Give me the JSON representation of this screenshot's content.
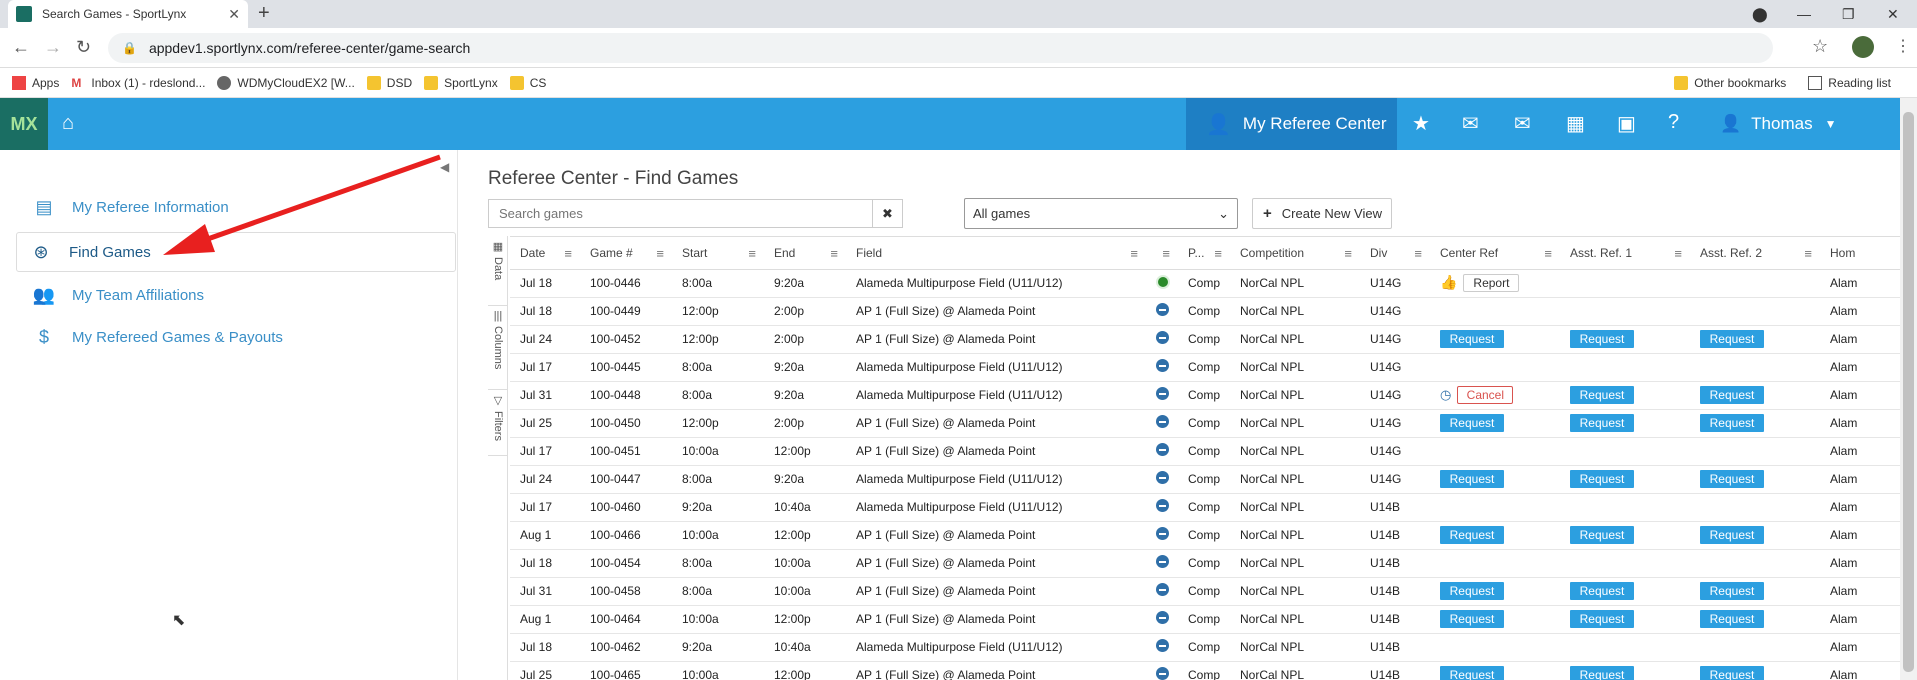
{
  "browser": {
    "tab_title": "Search Games - SportLynx",
    "url": "appdev1.sportlynx.com/referee-center/game-search",
    "bookmarks": [
      "Apps",
      "Inbox (1) - rdeslond...",
      "WDMyCloudEX2 [W...",
      "DSD",
      "SportLynx",
      "CS"
    ],
    "other_bookmarks": "Other bookmarks",
    "reading_list": "Reading list"
  },
  "appnav": {
    "logo": "MX",
    "center_label": "My Referee Center",
    "user_name": "Thomas"
  },
  "sidebar": {
    "items": [
      {
        "label": "My Referee Information",
        "icon": "id-card-icon"
      },
      {
        "label": "Find Games",
        "icon": "search-globe-icon",
        "active": true
      },
      {
        "label": "My Team Affiliations",
        "icon": "users-icon"
      },
      {
        "label": "My Refereed Games & Payouts",
        "icon": "dollar-icon"
      }
    ]
  },
  "main": {
    "title": "Referee Center - Find Games",
    "search_placeholder": "Search games",
    "view_select": "All games",
    "create_view": "Create New View",
    "side_tabs": [
      "Data",
      "Columns",
      "Filters"
    ]
  },
  "grid": {
    "columns": [
      "Date",
      "Game #",
      "Start",
      "End",
      "Field",
      "",
      "P...",
      "Competition",
      "Div",
      "Center Ref",
      "Asst. Ref. 1",
      "Asst. Ref. 2",
      "Hom"
    ],
    "rows": [
      {
        "date": "Jul 18",
        "game": "100-0446",
        "start": "8:00a",
        "end": "9:20a",
        "field": "Alameda Multipurpose Field (U11/U12)",
        "status": "ball",
        "p": "Comp",
        "comp": "NorCal NPL",
        "div": "U14G",
        "center": "report",
        "a1": "",
        "a2": "",
        "home": "Alam"
      },
      {
        "date": "Jul 18",
        "game": "100-0449",
        "start": "12:00p",
        "end": "2:00p",
        "field": "AP 1 (Full Size) @ Alameda Point",
        "status": "dot",
        "p": "Comp",
        "comp": "NorCal NPL",
        "div": "U14G",
        "center": "",
        "a1": "",
        "a2": "",
        "home": "Alam"
      },
      {
        "date": "Jul 24",
        "game": "100-0452",
        "start": "12:00p",
        "end": "2:00p",
        "field": "AP 1 (Full Size) @ Alameda Point",
        "status": "dot",
        "p": "Comp",
        "comp": "NorCal NPL",
        "div": "U14G",
        "center": "request",
        "a1": "request",
        "a2": "request",
        "home": "Alam"
      },
      {
        "date": "Jul 17",
        "game": "100-0445",
        "start": "8:00a",
        "end": "9:20a",
        "field": "Alameda Multipurpose Field (U11/U12)",
        "status": "dot",
        "p": "Comp",
        "comp": "NorCal NPL",
        "div": "U14G",
        "center": "",
        "a1": "",
        "a2": "",
        "home": "Alam"
      },
      {
        "date": "Jul 31",
        "game": "100-0448",
        "start": "8:00a",
        "end": "9:20a",
        "field": "Alameda Multipurpose Field (U11/U12)",
        "status": "dot",
        "p": "Comp",
        "comp": "NorCal NPL",
        "div": "U14G",
        "center": "cancel",
        "a1": "request",
        "a2": "request",
        "home": "Alam"
      },
      {
        "date": "Jul 25",
        "game": "100-0450",
        "start": "12:00p",
        "end": "2:00p",
        "field": "AP 1 (Full Size) @ Alameda Point",
        "status": "dot",
        "p": "Comp",
        "comp": "NorCal NPL",
        "div": "U14G",
        "center": "request",
        "a1": "request",
        "a2": "request",
        "home": "Alam"
      },
      {
        "date": "Jul 17",
        "game": "100-0451",
        "start": "10:00a",
        "end": "12:00p",
        "field": "AP 1 (Full Size) @ Alameda Point",
        "status": "dot",
        "p": "Comp",
        "comp": "NorCal NPL",
        "div": "U14G",
        "center": "",
        "a1": "",
        "a2": "",
        "home": "Alam"
      },
      {
        "date": "Jul 24",
        "game": "100-0447",
        "start": "8:00a",
        "end": "9:20a",
        "field": "Alameda Multipurpose Field (U11/U12)",
        "status": "dot",
        "p": "Comp",
        "comp": "NorCal NPL",
        "div": "U14G",
        "center": "request",
        "a1": "request",
        "a2": "request",
        "home": "Alam"
      },
      {
        "date": "Jul 17",
        "game": "100-0460",
        "start": "9:20a",
        "end": "10:40a",
        "field": "Alameda Multipurpose Field (U11/U12)",
        "status": "dot",
        "p": "Comp",
        "comp": "NorCal NPL",
        "div": "U14B",
        "center": "",
        "a1": "",
        "a2": "",
        "home": "Alam"
      },
      {
        "date": "Aug 1",
        "game": "100-0466",
        "start": "10:00a",
        "end": "12:00p",
        "field": "AP 1 (Full Size) @ Alameda Point",
        "status": "dot",
        "p": "Comp",
        "comp": "NorCal NPL",
        "div": "U14B",
        "center": "request",
        "a1": "request",
        "a2": "request",
        "home": "Alam"
      },
      {
        "date": "Jul 18",
        "game": "100-0454",
        "start": "8:00a",
        "end": "10:00a",
        "field": "AP 1 (Full Size) @ Alameda Point",
        "status": "dot",
        "p": "Comp",
        "comp": "NorCal NPL",
        "div": "U14B",
        "center": "",
        "a1": "",
        "a2": "",
        "home": "Alam"
      },
      {
        "date": "Jul 31",
        "game": "100-0458",
        "start": "8:00a",
        "end": "10:00a",
        "field": "AP 1 (Full Size) @ Alameda Point",
        "status": "dot",
        "p": "Comp",
        "comp": "NorCal NPL",
        "div": "U14B",
        "center": "request",
        "a1": "request",
        "a2": "request",
        "home": "Alam"
      },
      {
        "date": "Aug 1",
        "game": "100-0464",
        "start": "10:00a",
        "end": "12:00p",
        "field": "AP 1 (Full Size) @ Alameda Point",
        "status": "dot",
        "p": "Comp",
        "comp": "NorCal NPL",
        "div": "U14B",
        "center": "request",
        "a1": "request",
        "a2": "request",
        "home": "Alam"
      },
      {
        "date": "Jul 18",
        "game": "100-0462",
        "start": "9:20a",
        "end": "10:40a",
        "field": "Alameda Multipurpose Field (U11/U12)",
        "status": "dot",
        "p": "Comp",
        "comp": "NorCal NPL",
        "div": "U14B",
        "center": "",
        "a1": "",
        "a2": "",
        "home": "Alam"
      },
      {
        "date": "Jul 25",
        "game": "100-0465",
        "start": "10:00a",
        "end": "12:00p",
        "field": "AP 1 (Full Size) @ Alameda Point",
        "status": "dot",
        "p": "Comp",
        "comp": "NorCal NPL",
        "div": "U14B",
        "center": "request",
        "a1": "request",
        "a2": "request",
        "home": "Alam"
      }
    ],
    "labels": {
      "request": "Request",
      "cancel": "Cancel",
      "report": "Report"
    }
  }
}
